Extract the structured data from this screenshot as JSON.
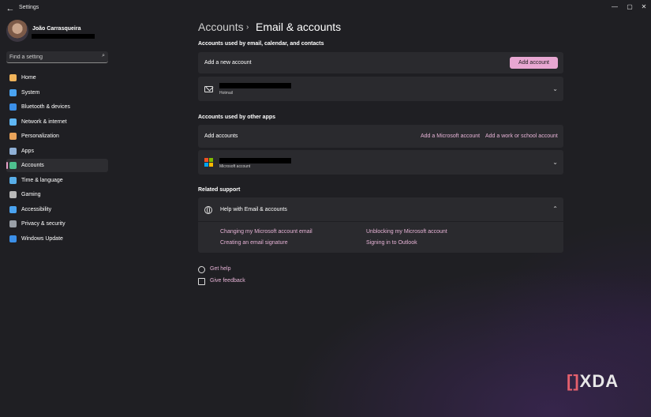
{
  "window": {
    "title": "Settings",
    "controls": {
      "minimize": "—",
      "maximize": "▢",
      "close": "✕"
    }
  },
  "profile": {
    "name": "João Carrasqueira"
  },
  "search": {
    "placeholder": "Find a setting"
  },
  "nav": [
    {
      "label": "Home",
      "icon": "home-icon",
      "color": "#f0b35a"
    },
    {
      "label": "System",
      "icon": "system-icon",
      "color": "#4aa3f0"
    },
    {
      "label": "Bluetooth & devices",
      "icon": "bluetooth-icon",
      "color": "#3b8fe8"
    },
    {
      "label": "Network & internet",
      "icon": "wifi-icon",
      "color": "#5fb7f5"
    },
    {
      "label": "Personalization",
      "icon": "brush-icon",
      "color": "#e9a35a"
    },
    {
      "label": "Apps",
      "icon": "apps-icon",
      "color": "#8fb0d6"
    },
    {
      "label": "Accounts",
      "icon": "person-icon",
      "color": "#4ec08f"
    },
    {
      "label": "Time & language",
      "icon": "globe-clock-icon",
      "color": "#58aee8"
    },
    {
      "label": "Gaming",
      "icon": "gamepad-icon",
      "color": "#b8b8b8"
    },
    {
      "label": "Accessibility",
      "icon": "accessibility-icon",
      "color": "#4aa3f0"
    },
    {
      "label": "Privacy & security",
      "icon": "shield-icon",
      "color": "#9aa0a8"
    },
    {
      "label": "Windows Update",
      "icon": "update-icon",
      "color": "#3b8fe8"
    }
  ],
  "active_nav": "Accounts",
  "breadcrumb": {
    "parent": "Accounts",
    "separator": "›",
    "current": "Email & accounts"
  },
  "email_section": {
    "heading": "Accounts used by email, calendar, and contacts",
    "add_row_label": "Add a new account",
    "add_button": "Add account",
    "account_provider": "Hotmail"
  },
  "apps_section": {
    "heading": "Accounts used by other apps",
    "add_row_label": "Add accounts",
    "add_microsoft": "Add a Microsoft account",
    "add_work": "Add a work or school account",
    "account_type": "Microsoft account"
  },
  "support": {
    "heading": "Related support",
    "help_title": "Help with Email & accounts",
    "links": [
      "Changing my Microsoft account email",
      "Unblocking my Microsoft account",
      "Creating an email signature",
      "Signing in to Outlook"
    ]
  },
  "footer": {
    "get_help": "Get help",
    "give_feedback": "Give feedback"
  },
  "watermark": {
    "mark": "[]",
    "text": "XDA"
  },
  "colors": {
    "accent": "#e8a7d2",
    "link": "#e6b3d6",
    "card": "#2a2a2e",
    "background": "#1f1f23"
  }
}
